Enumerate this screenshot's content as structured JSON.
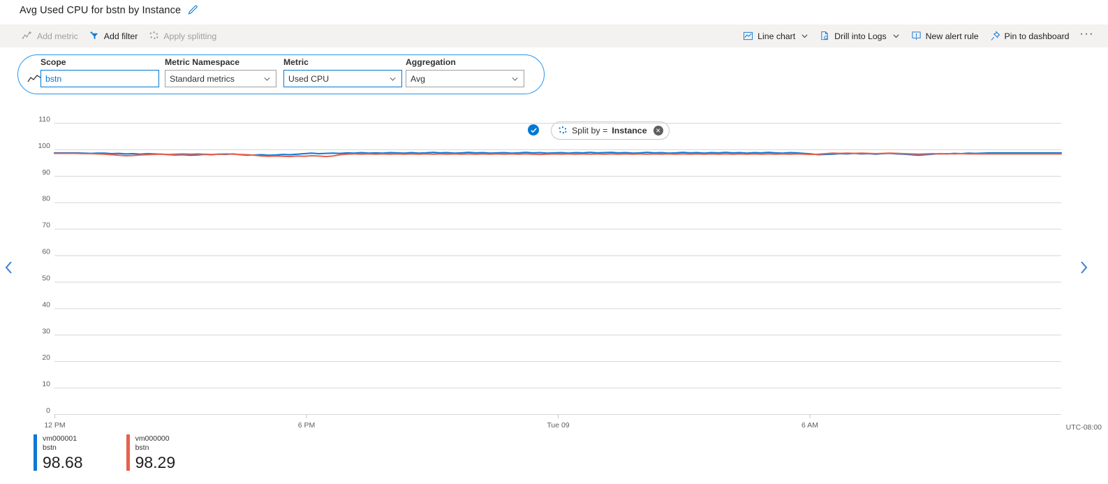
{
  "header": {
    "title": "Avg Used CPU for bstn by Instance",
    "edit_icon": "pencil-icon"
  },
  "toolbar": {
    "left_items": [
      {
        "label": "Add metric",
        "icon": "add-metric-icon",
        "disabled": true
      },
      {
        "label": "Add filter",
        "icon": "add-filter-icon",
        "disabled": false
      },
      {
        "label": "Apply splitting",
        "icon": "apply-splitting-icon",
        "disabled": true
      }
    ],
    "right_items": [
      {
        "label": "Line chart",
        "icon": "line-chart-icon",
        "caret": true
      },
      {
        "label": "Drill into Logs",
        "icon": "drill-logs-icon",
        "caret": true
      },
      {
        "label": "New alert rule",
        "icon": "alert-rule-icon",
        "caret": false
      },
      {
        "label": "Pin to dashboard",
        "icon": "pin-icon",
        "caret": false
      }
    ],
    "more_label": "···"
  },
  "selector": {
    "icon": "metric-chart-icon",
    "scope": {
      "label": "Scope",
      "value": "bstn"
    },
    "namespace": {
      "label": "Metric Namespace",
      "value": "Standard metrics"
    },
    "metric": {
      "label": "Metric",
      "value": "Used CPU"
    },
    "aggregation": {
      "label": "Aggregation",
      "value": "Avg"
    },
    "applied_check": "✓",
    "split_by": {
      "prefix": "Split by = ",
      "value": "Instance",
      "icon": "splitting-icon",
      "remove_label": "✕"
    }
  },
  "chart_data": {
    "type": "line",
    "title": "Avg Used CPU for bstn by Instance",
    "xlabel": "",
    "ylabel": "",
    "ylim": [
      0,
      115
    ],
    "yticks": [
      0,
      10,
      20,
      30,
      40,
      50,
      60,
      70,
      80,
      90,
      100,
      110
    ],
    "xticks": [
      "12 PM",
      "6 PM",
      "Tue 09",
      "6 AM"
    ],
    "xtick_positions": [
      0,
      0.25,
      0.5,
      0.75
    ],
    "timezone_label": "UTC-08:00",
    "grid": true,
    "legend_position": "bottom-left",
    "series": [
      {
        "name": "vm000001",
        "resource": "bstn",
        "value": "98.68",
        "color": "#0f78d4",
        "values": [
          98.7,
          98.7,
          98.7,
          98.7,
          98.6,
          98.5,
          98.6,
          98.6,
          98.4,
          98.5,
          98.3,
          98.4,
          98.2,
          98.4,
          98.3,
          98.2,
          98.0,
          97.9,
          98.0,
          97.8,
          97.9,
          98.1,
          98.0,
          98.2,
          98.1,
          98.3,
          98.0,
          97.8,
          97.9,
          98.0,
          97.8,
          97.9,
          98.1,
          98.0,
          98.2,
          98.4,
          98.6,
          98.4,
          98.5,
          98.6,
          98.5,
          98.7,
          98.6,
          98.8,
          98.6,
          98.7,
          98.6,
          98.8,
          98.7,
          98.6,
          98.8,
          98.6,
          98.7,
          98.9,
          98.7,
          98.8,
          98.6,
          98.7,
          98.9,
          98.7,
          98.8,
          98.6,
          98.7,
          98.8,
          98.6,
          98.7,
          98.9,
          98.7,
          98.8,
          98.6,
          98.7,
          98.8,
          98.6,
          98.8,
          98.7,
          98.9,
          98.7,
          98.8,
          98.9,
          98.7,
          98.8,
          98.6,
          98.7,
          98.9,
          98.7,
          98.8,
          98.6,
          98.7,
          98.9,
          98.7,
          98.8,
          98.6,
          98.8,
          98.7,
          98.9,
          98.7,
          98.8,
          98.6,
          98.8,
          98.7,
          98.9,
          98.7,
          98.6,
          98.8,
          98.7,
          98.5,
          98.3,
          98.0,
          98.1,
          98.2,
          98.4,
          98.3,
          98.5,
          98.3,
          98.4,
          98.2,
          98.4,
          98.5,
          98.3,
          98.2,
          98.0,
          97.8,
          98.0,
          98.2,
          98.4,
          98.3,
          98.5,
          98.4,
          98.6,
          98.5,
          98.6,
          98.7,
          98.68,
          98.68,
          98.68,
          98.68,
          98.68,
          98.68,
          98.68,
          98.68,
          98.68,
          98.68
        ]
      },
      {
        "name": "vm000000",
        "resource": "bstn",
        "value": "98.29",
        "color": "#e8604c",
        "values": [
          98.5,
          98.5,
          98.5,
          98.5,
          98.4,
          98.4,
          98.3,
          98.2,
          98.0,
          97.8,
          97.6,
          97.7,
          97.9,
          98.0,
          98.1,
          98.2,
          98.1,
          98.2,
          98.3,
          98.2,
          98.3,
          98.2,
          98.1,
          98.2,
          98.3,
          98.2,
          98.1,
          98.0,
          97.8,
          97.5,
          97.4,
          97.5,
          97.4,
          97.3,
          97.5,
          97.4,
          97.6,
          97.5,
          97.3,
          97.5,
          98.0,
          98.2,
          98.3,
          98.2,
          98.3,
          98.2,
          98.3,
          98.2,
          98.3,
          98.2,
          98.3,
          98.2,
          98.3,
          98.2,
          98.3,
          98.2,
          98.3,
          98.2,
          98.3,
          98.2,
          98.3,
          98.2,
          98.3,
          98.2,
          98.3,
          98.2,
          98.3,
          98.2,
          98.1,
          98.2,
          98.3,
          98.2,
          98.3,
          98.2,
          98.3,
          98.2,
          98.3,
          98.2,
          98.3,
          98.2,
          98.3,
          98.2,
          98.3,
          98.2,
          98.3,
          98.2,
          98.3,
          98.2,
          98.3,
          98.2,
          98.3,
          98.2,
          98.3,
          98.2,
          98.3,
          98.2,
          98.3,
          98.2,
          98.3,
          98.2,
          98.3,
          98.2,
          98.3,
          98.2,
          98.3,
          98.2,
          98.1,
          98.2,
          98.4,
          98.6,
          98.5,
          98.6,
          98.5,
          98.6,
          98.5,
          98.4,
          98.5,
          98.6,
          98.5,
          98.4,
          98.3,
          98.2,
          98.3,
          98.4,
          98.3,
          98.4,
          98.3,
          98.4,
          98.3,
          98.29,
          98.29,
          98.29,
          98.29,
          98.29,
          98.29,
          98.29,
          98.29,
          98.29,
          98.29,
          98.29,
          98.29,
          98.29
        ]
      }
    ]
  },
  "navigation": {
    "prev_label": "‹",
    "next_label": "›"
  }
}
